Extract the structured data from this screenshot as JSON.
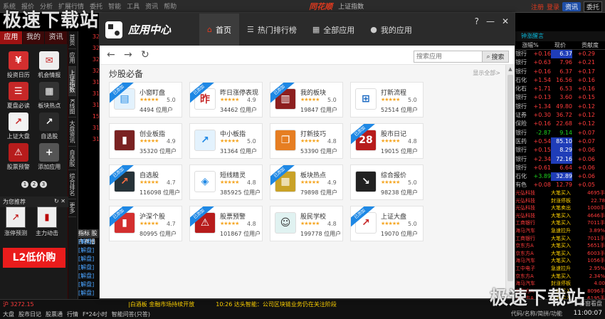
{
  "host": {
    "menu": [
      "系统",
      "报价",
      "分析",
      "扩展行情",
      "委托",
      "智能",
      "工具",
      "资讯",
      "帮助"
    ],
    "brand": "同花顺",
    "index_name": "上证指数",
    "right_links": [
      "注册",
      "登录"
    ],
    "pill": "资讯",
    "select": "委托"
  },
  "left_panel": {
    "tabs": [
      "应用",
      "我的",
      "资讯"
    ],
    "apps": [
      {
        "label": "投资日历",
        "icon": "calendar-icon",
        "color": "#d32f2f",
        "glyph": "¥"
      },
      {
        "label": "机会情报",
        "icon": "report-icon",
        "color": "#eeeeee",
        "glyph": "✉"
      },
      {
        "label": "夏盘必读",
        "icon": "book-icon",
        "color": "#c62828",
        "glyph": "☰"
      },
      {
        "label": "板块热点",
        "icon": "sectors-icon",
        "color": "#333333",
        "glyph": "▦"
      },
      {
        "label": "上证大盘",
        "icon": "index-chart-icon",
        "color": "#f2f2f2",
        "glyph": "↗"
      },
      {
        "label": "自选股",
        "icon": "watchlist-icon",
        "color": "#2a2a2a",
        "glyph": "↗"
      },
      {
        "label": "股票预警",
        "icon": "alarm-icon",
        "color": "#b71c1c",
        "glyph": "⚠"
      },
      {
        "label": "添加应用",
        "icon": "add-icon",
        "color": "#555555",
        "glyph": "+"
      }
    ],
    "pages": [
      "1",
      "2",
      "3"
    ],
    "recommend_title": "为您推荐",
    "recommend": [
      {
        "label": "涨停预测",
        "icon": "limit-up-icon",
        "glyph": "↗"
      },
      {
        "label": "主力动击",
        "icon": "main-force-icon",
        "glyph": "▮"
      }
    ],
    "banner": "L2低价购"
  },
  "vtabs": [
    "首页",
    "应用",
    "上证指数",
    "K线图",
    "大盘资讯",
    "自选股",
    "综合排名",
    "更多"
  ],
  "mid_values": [
    "32",
    "32",
    "32",
    "32",
    "31",
    "31",
    "31",
    "15",
    "31",
    "31"
  ],
  "jiedu": {
    "tabs": [
      "指标",
      "股市直播"
    ],
    "rows": [
      "[解盘]",
      "[解盘]",
      "[解盘]",
      "[解盘]",
      "[解盘]",
      "[解盘]",
      "[解盘]"
    ]
  },
  "window": {
    "title": "应用中心",
    "nav": [
      {
        "label": "首页",
        "icon": "home-icon",
        "glyph": "⌂",
        "active": true
      },
      {
        "label": "热门排行榜",
        "icon": "list-icon",
        "glyph": "☰",
        "active": false
      },
      {
        "label": "全部应用",
        "icon": "grid-icon",
        "glyph": "▦",
        "active": false
      },
      {
        "label": "我的应用",
        "icon": "user-icon",
        "glyph": "●",
        "active": false
      }
    ],
    "controls": [
      "?",
      "—",
      "✕"
    ],
    "search_placeholder": "搜索应用",
    "search_button": "搜索",
    "section_title": "炒股必备",
    "section_more": "显示全部>",
    "badge": "已添加",
    "cards": [
      {
        "name": "小窗盯盘",
        "score": "5.0",
        "users": "4494 位用户",
        "glyph": "▤",
        "color": "#1e88e5",
        "bg": "#e3f2fd",
        "badge": true
      },
      {
        "name": "昨日涨停表现",
        "score": "4.9",
        "users": "34462 位用户",
        "glyph": "昨",
        "color": "#c62828",
        "bg": "#fff",
        "badge": true
      },
      {
        "name": "我的板块",
        "score": "5.0",
        "users": "19847 位用户",
        "glyph": "▥",
        "color": "#fff",
        "bg": "#8d1f1f",
        "badge": true
      },
      {
        "name": "打新流程",
        "score": "5.0",
        "users": "52514 位用户",
        "glyph": "⊞",
        "color": "#1565c0",
        "bg": "#fff",
        "badge": false
      },
      {
        "name": "创业板指",
        "score": "4.9",
        "users": "35320 位用户",
        "glyph": "▮",
        "color": "#fff",
        "bg": "#7a2222",
        "badge": false
      },
      {
        "name": "中小板指",
        "score": "5.0",
        "users": "31364 位用户",
        "glyph": "↗",
        "color": "#1e88e5",
        "bg": "#e3f2fd",
        "badge": false
      },
      {
        "name": "打新技巧",
        "score": "4.8",
        "users": "53390 位用户",
        "glyph": "❐",
        "color": "#fff",
        "bg": "#e67e22",
        "badge": false
      },
      {
        "name": "股市日记",
        "score": "4.8",
        "users": "19015 位用户",
        "glyph": "28",
        "color": "#fff",
        "bg": "#b71c1c",
        "badge": true
      },
      {
        "name": "自选股",
        "score": "4.7",
        "users": "116098 位用户",
        "glyph": "↗",
        "color": "#ff7043",
        "bg": "#263238",
        "badge": true
      },
      {
        "name": "短线精灵",
        "score": "4.8",
        "users": "385925 位用户",
        "glyph": "◈",
        "color": "#1e88e5",
        "bg": "#fff",
        "badge": false
      },
      {
        "name": "板块热点",
        "score": "4.9",
        "users": "79898 位用户",
        "glyph": "▦",
        "color": "#fff",
        "bg": "#c9a227",
        "badge": true
      },
      {
        "name": "综合报价",
        "score": "5.0",
        "users": "98238 位用户",
        "glyph": "↘",
        "color": "#fff",
        "bg": "#222",
        "badge": false
      },
      {
        "name": "沪深个股",
        "score": "4.7",
        "users": "80995 位用户",
        "glyph": "▮",
        "color": "#fff",
        "bg": "#d32f2f",
        "badge": true
      },
      {
        "name": "股票预警",
        "score": "4.8",
        "users": "101867 位用户",
        "glyph": "⚠",
        "color": "#fff",
        "bg": "#b71c1c",
        "badge": true
      },
      {
        "name": "股民学校",
        "score": "4.8",
        "users": "199778 位用户",
        "glyph": "☺",
        "color": "#333",
        "bg": "#e0f2f1",
        "badge": false
      },
      {
        "name": "上证大盘",
        "score": "5.0",
        "users": "19070 位用户",
        "glyph": "↗",
        "color": "#c62828",
        "bg": "#fff",
        "badge": true
      }
    ]
  },
  "right_panel": {
    "header": "钟涨醒言",
    "cols": [
      "涨幅%",
      "现价",
      "贡献度"
    ],
    "rows": [
      {
        "n": "银行",
        "a": "+0.16",
        "b": "6.37",
        "c": "+0.29",
        "hl": true,
        "dir": "red"
      },
      {
        "n": "银行",
        "a": "+0.63",
        "b": "7.96",
        "c": "+0.21",
        "hl": false,
        "dir": "red"
      },
      {
        "n": "银行",
        "a": "+0.16",
        "b": "6.37",
        "c": "+0.17",
        "hl": false,
        "dir": "red"
      },
      {
        "n": "石化",
        "a": "+1.54",
        "b": "16.56",
        "c": "+0.16",
        "hl": false,
        "dir": "red"
      },
      {
        "n": "化石",
        "a": "+1.71",
        "b": "6.53",
        "c": "+0.16",
        "hl": false,
        "dir": "red"
      },
      {
        "n": "银行",
        "a": "+0.13",
        "b": "3.60",
        "c": "+0.15",
        "hl": false,
        "dir": "red"
      },
      {
        "n": "银行",
        "a": "+1.34",
        "b": "49.80",
        "c": "+0.12",
        "hl": false,
        "dir": "red"
      },
      {
        "n": "证券",
        "a": "+0.30",
        "b": "36.72",
        "c": "+0.12",
        "hl": false,
        "dir": "red"
      },
      {
        "n": "保险",
        "a": "+0.16",
        "b": "22.68",
        "c": "+0.12",
        "hl": false,
        "dir": "red"
      },
      {
        "n": "银行",
        "a": "-2.87",
        "b": "9.14",
        "c": "+0.07",
        "hl": false,
        "dir": "green"
      },
      {
        "n": "医药",
        "a": "+0.54",
        "b": "85.10",
        "c": "+0.07",
        "hl": true,
        "dir": "red"
      },
      {
        "n": "银行",
        "a": "+0.15",
        "b": "8.29",
        "c": "+0.06",
        "hl": true,
        "dir": "red"
      },
      {
        "n": "银行",
        "a": "+2.34",
        "b": "72.16",
        "c": "+0.06",
        "hl": true,
        "dir": "red"
      },
      {
        "n": "银行",
        "a": "+0.61",
        "b": "6.64",
        "c": "+0.06",
        "hl": false,
        "dir": "red"
      },
      {
        "n": "石化",
        "a": "+3.89",
        "b": "32.89",
        "c": "+0.06",
        "hl": true,
        "dir": "green"
      },
      {
        "n": "有色",
        "a": "+0.08",
        "b": "12.79",
        "c": "+0.05",
        "hl": false,
        "dir": "red"
      }
    ],
    "ticks": [
      {
        "a": "光弘科技",
        "b": "大笔买入",
        "c": "4695手"
      },
      {
        "a": "光弘科技",
        "b": "封涨停板",
        "c": "22.78"
      },
      {
        "a": "光弘科技",
        "b": "大笔卖出",
        "c": "1000手"
      },
      {
        "a": "光弘科技",
        "b": "大笔买入",
        "c": "4646手"
      },
      {
        "a": "工商银行",
        "b": "大笔买入",
        "c": "7011手"
      },
      {
        "a": "海马汽车",
        "b": "急速拉升",
        "c": "3.89%"
      },
      {
        "a": "工商银行",
        "b": "大笔买入",
        "c": "7011手"
      },
      {
        "a": "京东方A",
        "b": "大笔买入",
        "c": "5651手"
      },
      {
        "a": "京东方A",
        "b": "大笔买入",
        "c": "6003手"
      },
      {
        "a": "海马汽车",
        "b": "大笔买入",
        "c": "1056手"
      },
      {
        "a": "工中电子",
        "b": "急速拉升",
        "c": "2.95%"
      },
      {
        "a": "京东方A",
        "b": "大笔买入",
        "c": "2.34%"
      },
      {
        "a": "海马汽车",
        "b": "封涨停板",
        "c": "4.00"
      },
      {
        "a": "京东方A",
        "b": "大笔买入",
        "c": "8096手"
      },
      {
        "a": "京东方A",
        "b": "大笔买入",
        "c": "6195手"
      }
    ]
  },
  "status": {
    "index": "沪 3272.15",
    "ticker": "|白酒板 金融市场持续开放",
    "news": "10:26 达头智能：公司区块链业务仍在关注阶段",
    "tabs": [
      "大盘",
      "股市日记",
      "股票通",
      "行情",
      "F*24小时",
      "智能问答(只答)"
    ],
    "search": "代码/名称/简拼/功能",
    "clock": "11:00:07",
    "quick": "多窗看盘"
  },
  "watermark": "极速下载站"
}
